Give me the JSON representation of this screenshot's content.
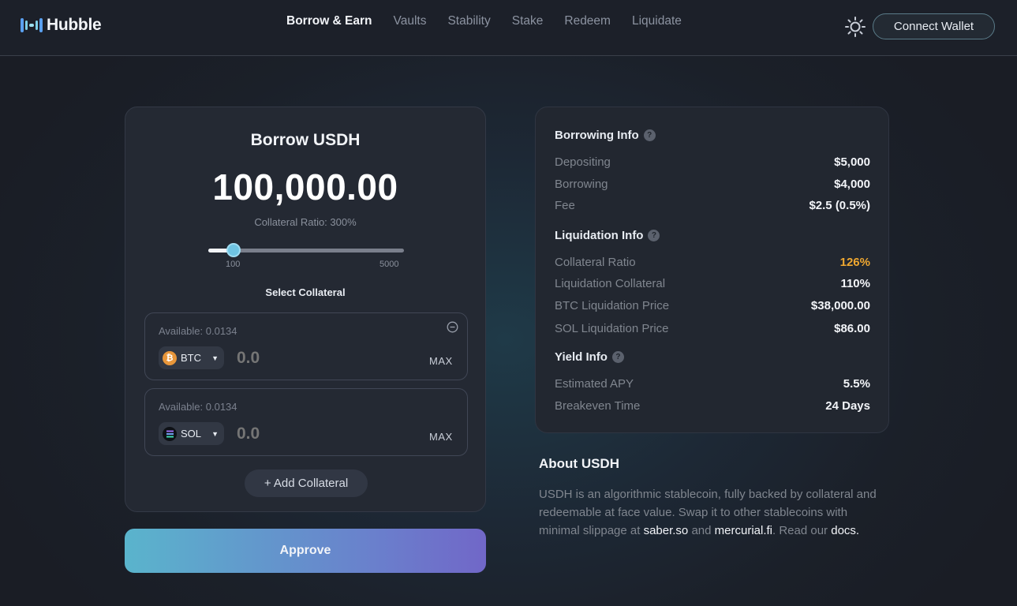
{
  "header": {
    "logo_text": "Hubble",
    "nav": [
      {
        "label": "Borrow & Earn",
        "active": true
      },
      {
        "label": "Vaults",
        "active": false
      },
      {
        "label": "Stability",
        "active": false
      },
      {
        "label": "Stake",
        "active": false
      },
      {
        "label": "Redeem",
        "active": false
      },
      {
        "label": "Liquidate",
        "active": false
      }
    ],
    "theme_icon": "sun-icon",
    "connect_label": "Connect Wallet"
  },
  "borrow": {
    "title": "Borrow USDH",
    "amount": "100,000.00",
    "ratio_label": "Collateral Ratio: 300%",
    "slider": {
      "min_label": "100",
      "max_label": "5000",
      "value_fraction": 0.13
    },
    "select_label": "Select Collateral",
    "collaterals": [
      {
        "available": "Available: 0.0134",
        "token": "BTC",
        "icon": "bitcoin-icon",
        "placeholder": "0.0",
        "max_label": "MAX",
        "removable": true
      },
      {
        "available": "Available: 0.0134",
        "token": "SOL",
        "icon": "solana-icon",
        "placeholder": "0.0",
        "max_label": "MAX",
        "removable": false
      }
    ],
    "add_label": "+ Add Collateral",
    "approve_label": "Approve"
  },
  "info": {
    "borrowing": {
      "title": "Borrowing Info",
      "rows": [
        {
          "label": "Depositing",
          "value": "$5,000"
        },
        {
          "label": "Borrowing",
          "value": "$4,000"
        },
        {
          "label": "Fee",
          "value": "$2.5 (0.5%)"
        }
      ]
    },
    "liquidation": {
      "title": "Liquidation Info",
      "rows": [
        {
          "label": "Collateral Ratio",
          "value": "126%"
        },
        {
          "label": "Liquidation Collateral",
          "value": "110%"
        },
        {
          "label": "BTC Liquidation Price",
          "value": "$38,000.00"
        },
        {
          "label": "SOL Liquidation Price",
          "value": "$86.00"
        }
      ]
    },
    "yield": {
      "title": "Yield Info",
      "rows": [
        {
          "label": "Estimated APY",
          "value": "5.5%"
        },
        {
          "label": "Breakeven Time",
          "value": "24 Days"
        }
      ]
    }
  },
  "about": {
    "title": "About USDH",
    "text_1": "USDH is an algorithmic stablecoin, fully backed by collateral and redeemable at face value. Swap it to other stablecoins with minimal slippage at ",
    "link_saber": "saber.so",
    "text_2": " and ",
    "link_mercurial": "mercurial.fi",
    "text_3": ". Read our ",
    "link_docs": "docs.",
    "text_4": ""
  },
  "colors": {
    "accent": "#6fc4e3",
    "warning": "#f0a830",
    "approve_gradient_start": "#5ab4cc",
    "approve_gradient_end": "#7167c8"
  }
}
